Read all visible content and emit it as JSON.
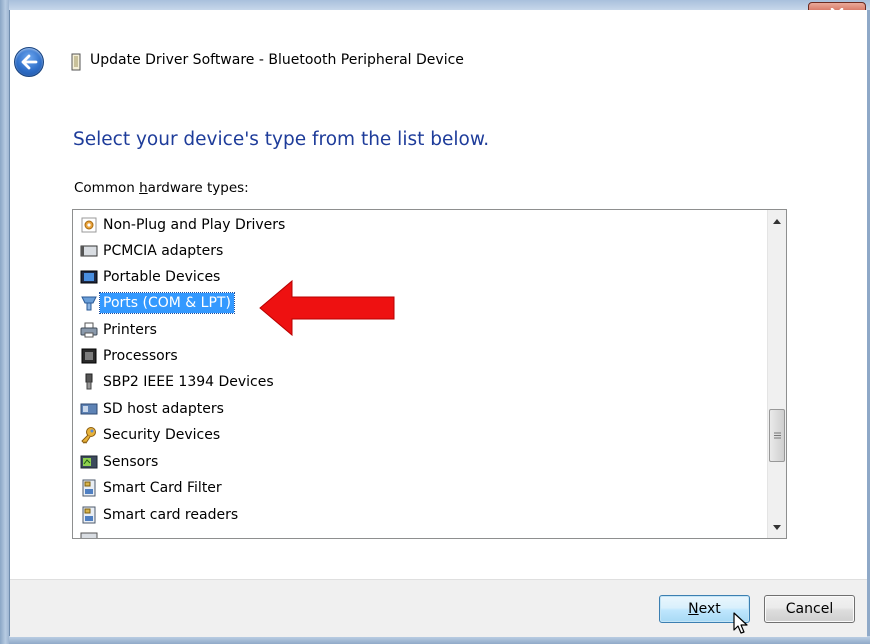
{
  "window": {
    "title": "Update Driver Software - Bluetooth Peripheral Device",
    "close_icon": "close-icon",
    "back_icon": "back-arrow-icon"
  },
  "main": {
    "heading": "Select your device's type from the list below.",
    "list_caption_pre": "Common ",
    "list_caption_underlined": "h",
    "list_caption_post": "ardware types:"
  },
  "hardware_types": {
    "items": [
      {
        "label": "Non-Plug and Play Drivers",
        "icon": "gear-icon"
      },
      {
        "label": "PCMCIA adapters",
        "icon": "pcmcia-card-icon"
      },
      {
        "label": "Portable Devices",
        "icon": "portable-device-icon"
      },
      {
        "label": "Ports (COM & LPT)",
        "icon": "port-plug-icon",
        "selected": true
      },
      {
        "label": "Printers",
        "icon": "printer-icon"
      },
      {
        "label": "Processors",
        "icon": "processor-icon"
      },
      {
        "label": "SBP2 IEEE 1394 Devices",
        "icon": "plug-icon"
      },
      {
        "label": "SD host adapters",
        "icon": "sd-card-icon"
      },
      {
        "label": "Security Devices",
        "icon": "security-key-icon"
      },
      {
        "label": "Sensors",
        "icon": "sensor-icon"
      },
      {
        "label": "Smart Card Filter",
        "icon": "smart-card-icon"
      },
      {
        "label": "Smart card readers",
        "icon": "smart-card-icon"
      }
    ],
    "scroll_level": 0.6
  },
  "footer": {
    "next_label_underlined": "N",
    "next_label_rest": "ext",
    "cancel_label": "Cancel"
  },
  "colors": {
    "heading_blue": "#1e3c9a",
    "selection_blue": "#3399ff",
    "annotation_red": "#ee1111"
  }
}
